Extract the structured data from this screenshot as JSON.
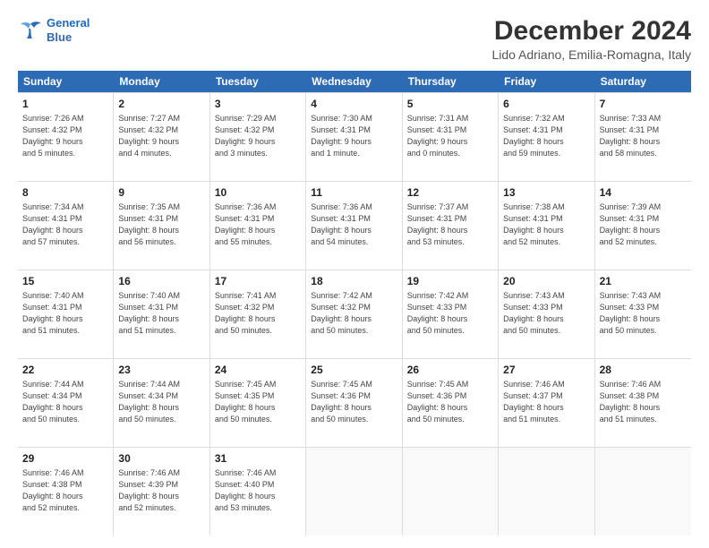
{
  "logo": {
    "line1": "General",
    "line2": "Blue"
  },
  "title": "December 2024",
  "location": "Lido Adriano, Emilia-Romagna, Italy",
  "header_days": [
    "Sunday",
    "Monday",
    "Tuesday",
    "Wednesday",
    "Thursday",
    "Friday",
    "Saturday"
  ],
  "weeks": [
    [
      {
        "day": "1",
        "info": "Sunrise: 7:26 AM\nSunset: 4:32 PM\nDaylight: 9 hours\nand 5 minutes."
      },
      {
        "day": "2",
        "info": "Sunrise: 7:27 AM\nSunset: 4:32 PM\nDaylight: 9 hours\nand 4 minutes."
      },
      {
        "day": "3",
        "info": "Sunrise: 7:29 AM\nSunset: 4:32 PM\nDaylight: 9 hours\nand 3 minutes."
      },
      {
        "day": "4",
        "info": "Sunrise: 7:30 AM\nSunset: 4:31 PM\nDaylight: 9 hours\nand 1 minute."
      },
      {
        "day": "5",
        "info": "Sunrise: 7:31 AM\nSunset: 4:31 PM\nDaylight: 9 hours\nand 0 minutes."
      },
      {
        "day": "6",
        "info": "Sunrise: 7:32 AM\nSunset: 4:31 PM\nDaylight: 8 hours\nand 59 minutes."
      },
      {
        "day": "7",
        "info": "Sunrise: 7:33 AM\nSunset: 4:31 PM\nDaylight: 8 hours\nand 58 minutes."
      }
    ],
    [
      {
        "day": "8",
        "info": "Sunrise: 7:34 AM\nSunset: 4:31 PM\nDaylight: 8 hours\nand 57 minutes."
      },
      {
        "day": "9",
        "info": "Sunrise: 7:35 AM\nSunset: 4:31 PM\nDaylight: 8 hours\nand 56 minutes."
      },
      {
        "day": "10",
        "info": "Sunrise: 7:36 AM\nSunset: 4:31 PM\nDaylight: 8 hours\nand 55 minutes."
      },
      {
        "day": "11",
        "info": "Sunrise: 7:36 AM\nSunset: 4:31 PM\nDaylight: 8 hours\nand 54 minutes."
      },
      {
        "day": "12",
        "info": "Sunrise: 7:37 AM\nSunset: 4:31 PM\nDaylight: 8 hours\nand 53 minutes."
      },
      {
        "day": "13",
        "info": "Sunrise: 7:38 AM\nSunset: 4:31 PM\nDaylight: 8 hours\nand 52 minutes."
      },
      {
        "day": "14",
        "info": "Sunrise: 7:39 AM\nSunset: 4:31 PM\nDaylight: 8 hours\nand 52 minutes."
      }
    ],
    [
      {
        "day": "15",
        "info": "Sunrise: 7:40 AM\nSunset: 4:31 PM\nDaylight: 8 hours\nand 51 minutes."
      },
      {
        "day": "16",
        "info": "Sunrise: 7:40 AM\nSunset: 4:31 PM\nDaylight: 8 hours\nand 51 minutes."
      },
      {
        "day": "17",
        "info": "Sunrise: 7:41 AM\nSunset: 4:32 PM\nDaylight: 8 hours\nand 50 minutes."
      },
      {
        "day": "18",
        "info": "Sunrise: 7:42 AM\nSunset: 4:32 PM\nDaylight: 8 hours\nand 50 minutes."
      },
      {
        "day": "19",
        "info": "Sunrise: 7:42 AM\nSunset: 4:33 PM\nDaylight: 8 hours\nand 50 minutes."
      },
      {
        "day": "20",
        "info": "Sunrise: 7:43 AM\nSunset: 4:33 PM\nDaylight: 8 hours\nand 50 minutes."
      },
      {
        "day": "21",
        "info": "Sunrise: 7:43 AM\nSunset: 4:33 PM\nDaylight: 8 hours\nand 50 minutes."
      }
    ],
    [
      {
        "day": "22",
        "info": "Sunrise: 7:44 AM\nSunset: 4:34 PM\nDaylight: 8 hours\nand 50 minutes."
      },
      {
        "day": "23",
        "info": "Sunrise: 7:44 AM\nSunset: 4:34 PM\nDaylight: 8 hours\nand 50 minutes."
      },
      {
        "day": "24",
        "info": "Sunrise: 7:45 AM\nSunset: 4:35 PM\nDaylight: 8 hours\nand 50 minutes."
      },
      {
        "day": "25",
        "info": "Sunrise: 7:45 AM\nSunset: 4:36 PM\nDaylight: 8 hours\nand 50 minutes."
      },
      {
        "day": "26",
        "info": "Sunrise: 7:45 AM\nSunset: 4:36 PM\nDaylight: 8 hours\nand 50 minutes."
      },
      {
        "day": "27",
        "info": "Sunrise: 7:46 AM\nSunset: 4:37 PM\nDaylight: 8 hours\nand 51 minutes."
      },
      {
        "day": "28",
        "info": "Sunrise: 7:46 AM\nSunset: 4:38 PM\nDaylight: 8 hours\nand 51 minutes."
      }
    ],
    [
      {
        "day": "29",
        "info": "Sunrise: 7:46 AM\nSunset: 4:38 PM\nDaylight: 8 hours\nand 52 minutes."
      },
      {
        "day": "30",
        "info": "Sunrise: 7:46 AM\nSunset: 4:39 PM\nDaylight: 8 hours\nand 52 minutes."
      },
      {
        "day": "31",
        "info": "Sunrise: 7:46 AM\nSunset: 4:40 PM\nDaylight: 8 hours\nand 53 minutes."
      },
      {
        "day": "",
        "info": ""
      },
      {
        "day": "",
        "info": ""
      },
      {
        "day": "",
        "info": ""
      },
      {
        "day": "",
        "info": ""
      }
    ]
  ]
}
